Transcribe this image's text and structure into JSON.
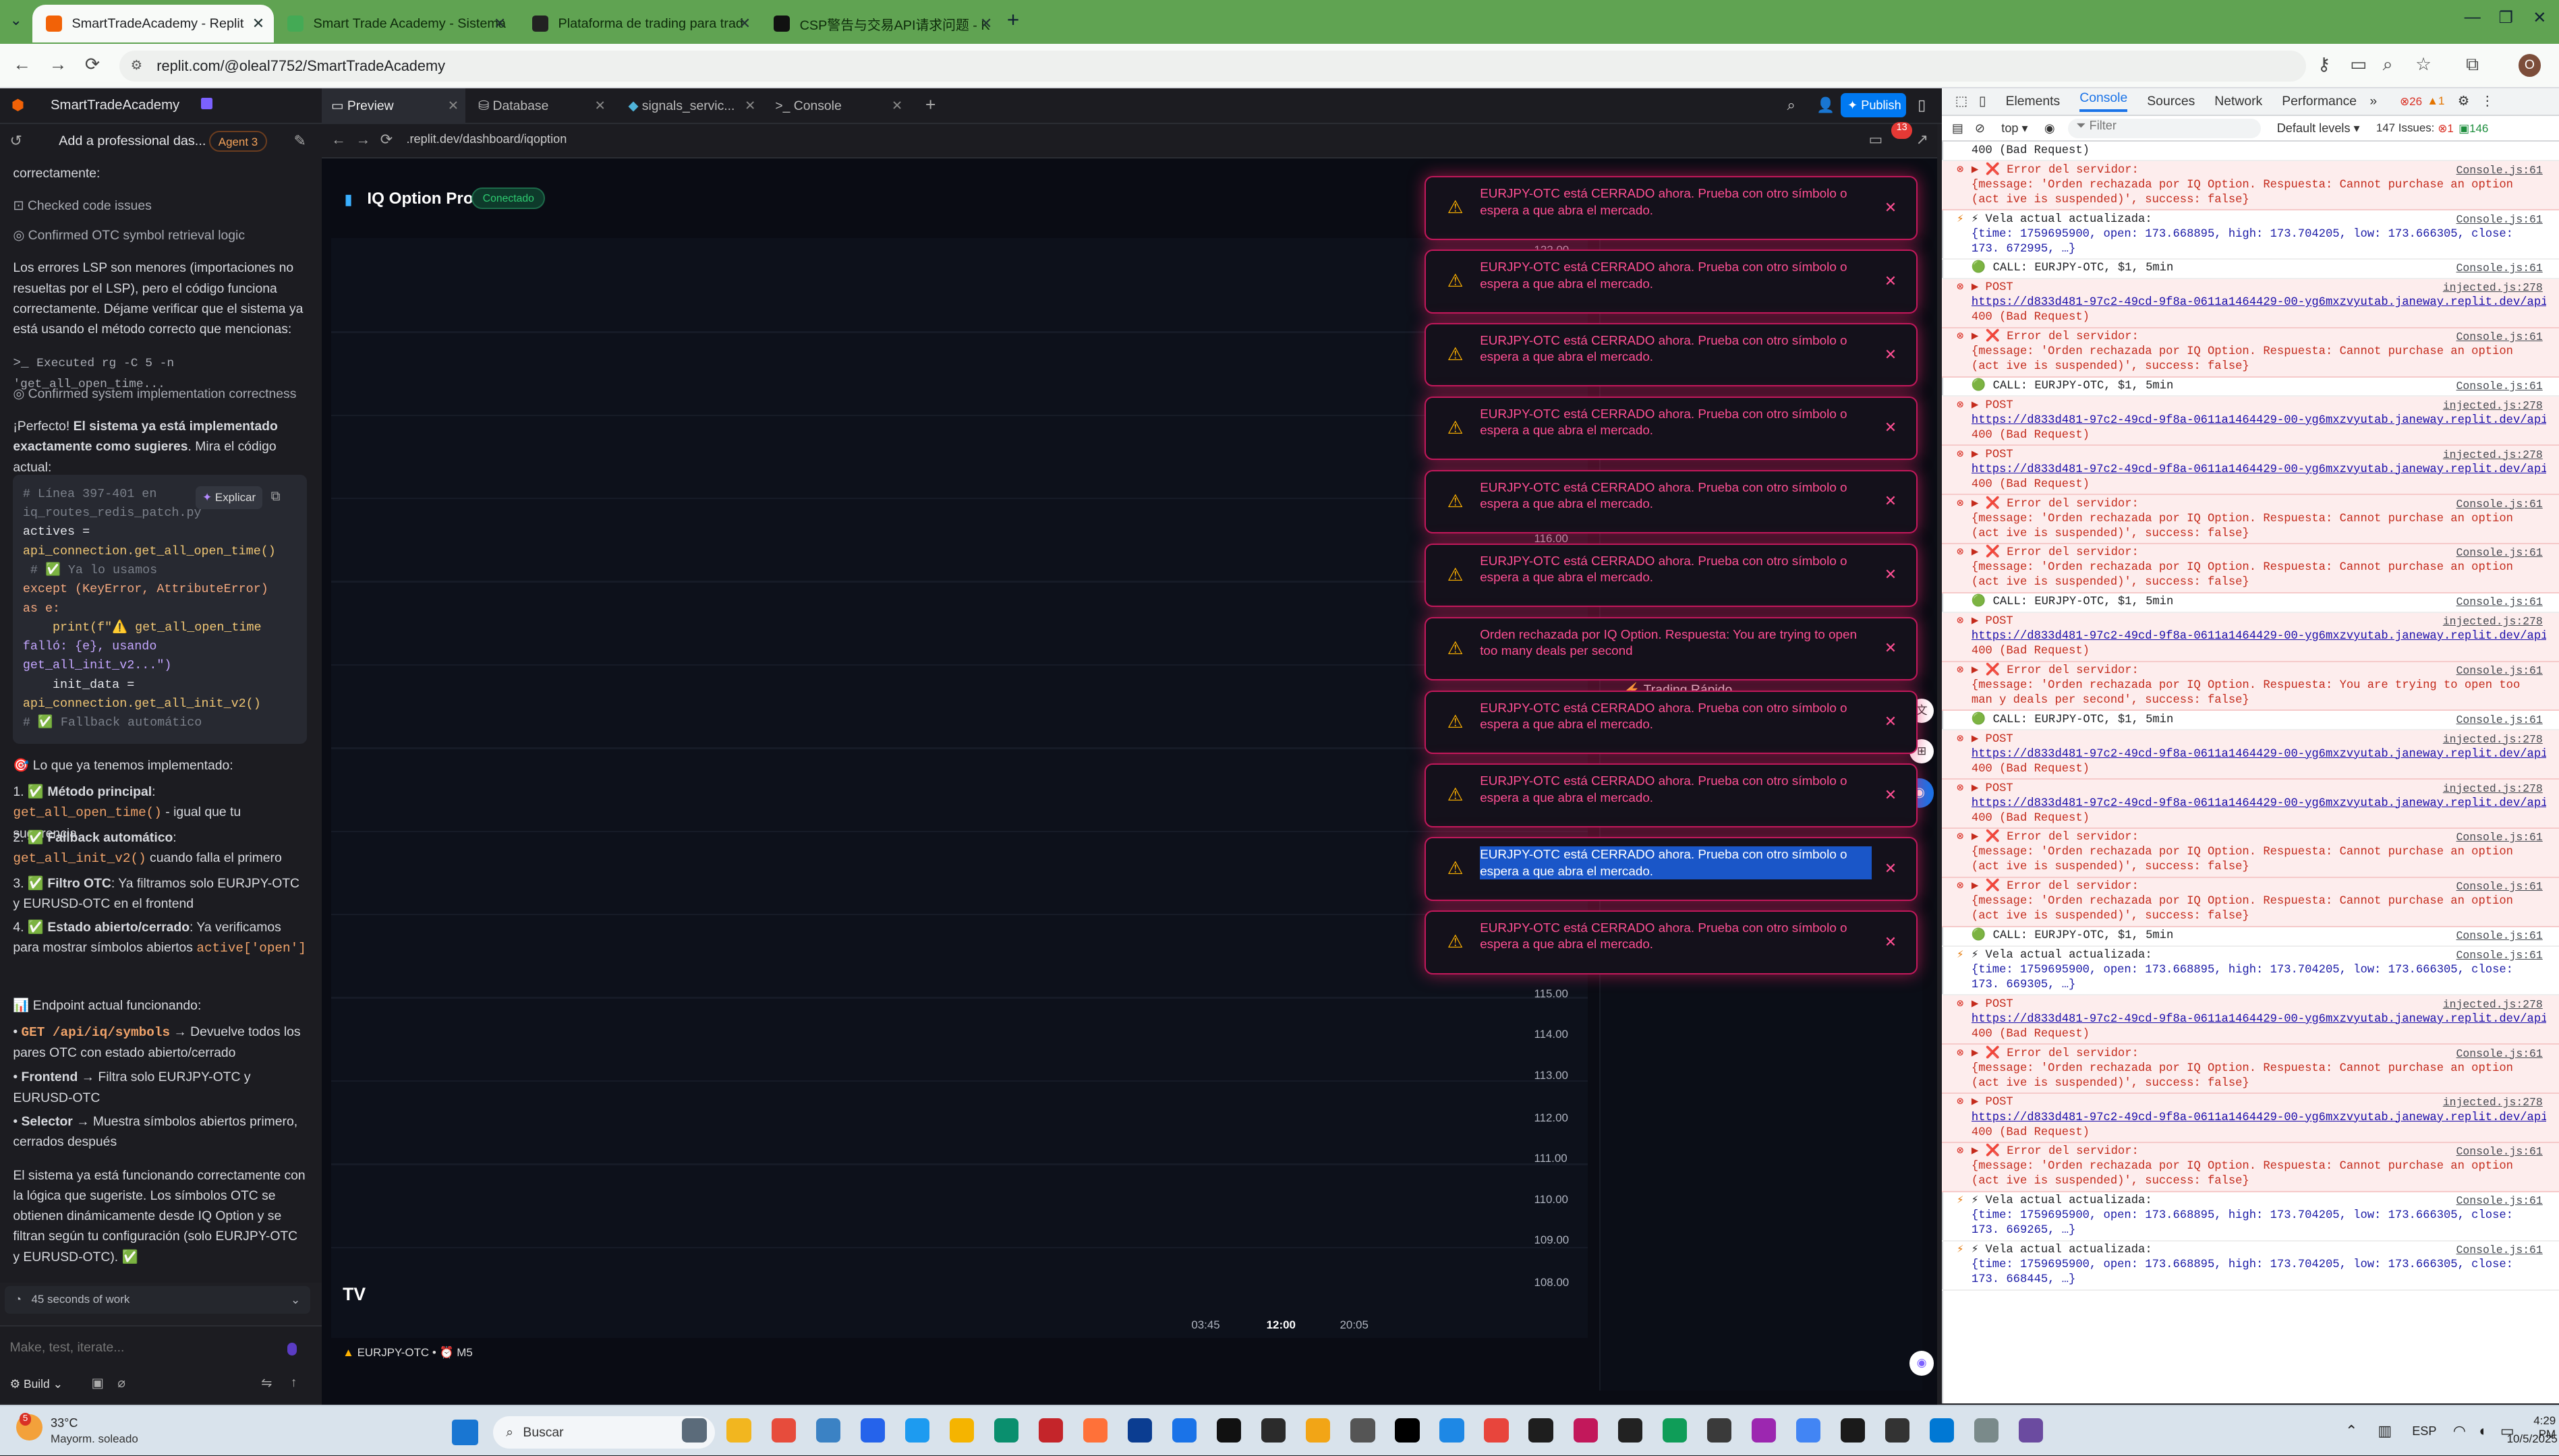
{
  "browser": {
    "tabs": [
      {
        "title": "SmartTradeAcademy - Replit",
        "active": true
      },
      {
        "title": "Smart Trade Academy - Sistema"
      },
      {
        "title": "Plataforma de trading para trad"
      },
      {
        "title": "CSP警告与交易API请求问题 - K"
      }
    ],
    "url": "replit.com/@oleal7752/SmartTradeAcademy"
  },
  "replit": {
    "project": "SmartTradeAcademy",
    "task": "Add a professional das...",
    "agent": "Agent 3",
    "tabs": [
      "Preview",
      "Database",
      "signals_servic...",
      "Console"
    ],
    "publish": "Publish",
    "preview_url": ".replit.dev/dashboard/iqoption"
  },
  "chat": {
    "l1": "correctamente:",
    "l2": "Checked code issues",
    "l3": "Confirmed OTC symbol retrieval logic",
    "p1": "Los errores LSP son menores (importaciones no resueltas por el LSP), pero el código funciona correctamente. Déjame verificar que el sistema ya está usando el método correcto que mencionas:",
    "l4": "Executed rg -C 5 -n 'get_all_open_time...",
    "l5": "Confirmed system implementation correctness",
    "p2a": "¡Perfecto! ",
    "p2b": "El sistema ya está implementado exactamente como sugieres",
    "p2c": ". Mira el código actual:",
    "code": [
      "# Línea 397-401 en",
      "iq_routes_redis_patch.py",
      "actives =",
      "api_connection.get_all_open_time()",
      " # ✅ Ya lo usamos",
      "except (KeyError, AttributeError)",
      "as e:",
      "    print(f\"⚠️ get_all_open_time",
      "falló: {e}, usando",
      "get_all_init_v2...\")",
      "    init_data =",
      "api_connection.get_all_init_v2()",
      "# ✅ Fallback automático"
    ],
    "explain": "Explicar",
    "h1": "🎯 Lo que ya tenemos implementado:",
    "items": [
      {
        "n": "1.",
        "b": "Método principal",
        "c": "get_all_open_time()",
        "t": " - igual que tu sugerencia"
      },
      {
        "n": "2.",
        "b": "Fallback automático",
        "c": "get_all_init_v2()",
        "t": " cuando falla el primero"
      },
      {
        "n": "3.",
        "b": "Filtro OTC",
        "c": "",
        "t": ": Ya filtramos solo EURJPY-OTC y EURUSD-OTC en el frontend"
      },
      {
        "n": "4.",
        "b": "Estado abierto/cerrado",
        "c": "active['open']",
        "t": ": Ya verificamos  para mostrar símbolos abiertos"
      }
    ],
    "h2": "📊 Endpoint actual funcionando:",
    "bul": [
      {
        "b": "GET /api/iq/symbols",
        "t": " → Devuelve todos los pares OTC con estado abierto/cerrado"
      },
      {
        "b": "Frontend",
        "t": " → Filtra solo EURJPY-OTC y EURUSD-OTC"
      },
      {
        "b": "Selector",
        "t": " → Muestra símbolos abiertos primero, cerrados después"
      }
    ],
    "p3": "El sistema ya está funcionando correctamente con la lógica que sugeriste. Los símbolos OTC se obtienen dinámicamente desde IQ Option y se filtran según tu configuración (solo EURJPY-OTC y EURUSD-OTC). ✅",
    "work": "45 seconds of work",
    "placeholder": "Make, test, iterate...",
    "build": "Build"
  },
  "app": {
    "title": "IQ Option Pro",
    "status": "Conectado",
    "symbol": "EURJPY-OTC • ⏰ M5",
    "notif_count": "13",
    "prices": [
      "122.00",
      "116.00",
      "115.00",
      "114.00",
      "113.00",
      "112.00",
      "111.00",
      "110.00",
      "109.00",
      "108.00"
    ],
    "times": [
      "03:45",
      "12:00",
      "20:05"
    ],
    "trading": "Trading Rápido",
    "toasts": [
      "EURJPY-OTC está CERRADO ahora. Prueba con otro símbolo o espera a que abra el mercado.",
      "EURJPY-OTC está CERRADO ahora. Prueba con otro símbolo o espera a que abra el mercado.",
      "EURJPY-OTC está CERRADO ahora. Prueba con otro símbolo o espera a que abra el mercado.",
      "EURJPY-OTC está CERRADO ahora. Prueba con otro símbolo o espera a que abra el mercado.",
      "EURJPY-OTC está CERRADO ahora. Prueba con otro símbolo o espera a que abra el mercado.",
      "EURJPY-OTC está CERRADO ahora. Prueba con otro símbolo o espera a que abra el mercado.",
      "Orden rechazada por IQ Option. Respuesta: You are trying to open too many deals per second",
      "EURJPY-OTC está CERRADO ahora. Prueba con otro símbolo o espera a que abra el mercado.",
      "EURJPY-OTC está CERRADO ahora. Prueba con otro símbolo o espera a que abra el mercado.",
      "EURJPY-OTC está CERRADO ahora. Prueba con otro símbolo o espera a que abra el mercado.",
      "EURJPY-OTC está CERRADO ahora. Prueba con otro símbolo o espera a que abra el mercado."
    ]
  },
  "devtools": {
    "tabs": [
      "Elements",
      "Console",
      "Sources",
      "Network",
      "Performance"
    ],
    "errors": "26",
    "warnings": "1",
    "issues": "147 Issues:",
    "issue_err": "1",
    "issue_info": "146",
    "context": "top",
    "filter": "Filter",
    "levels": "Default levels",
    "logs": [
      {
        "k": "plain",
        "t": "400 (Bad Request)"
      },
      {
        "k": "err",
        "t": "▶ ❌ Error del servidor:",
        "s": "{message: 'Orden rechazada por IQ Option. Respuesta: Cannot purchase an option (act ive is suspended)', success: false}",
        "src": "Console.js:61"
      },
      {
        "k": "warn",
        "t": "⚡ Vela actual actualizada:",
        "s": "{time: 1759695900, open: 173.668895, high: 173.704205, low: 173.666305, close: 173. 672995, …}",
        "src": "Console.js:61"
      },
      {
        "k": "plain",
        "t": "🟢 CALL: EURJPY-OTC, $1, 5min",
        "src": "Console.js:61"
      },
      {
        "k": "err",
        "t": "▶ POST",
        "l": "https://d833d481-97c2-49cd-9f8a-0611a1464429-00-yg6mxzvyutab.janeway.replit.dev/api/i...",
        "e": "400 (Bad Request)",
        "src": "injected.js:278"
      },
      {
        "k": "err",
        "t": "▶ ❌ Error del servidor:",
        "s": "{message: 'Orden rechazada por IQ Option. Respuesta: Cannot purchase an option (act ive is suspended)', success: false}",
        "src": "Console.js:61"
      },
      {
        "k": "plain",
        "t": "🟢 CALL: EURJPY-OTC, $1, 5min",
        "src": "Console.js:61"
      },
      {
        "k": "err",
        "t": "▶ POST",
        "l": "https://d833d481-97c2-49cd-9f8a-0611a1464429-00-yg6mxzvyutab.janeway.replit.dev/api/i...",
        "e": "400 (Bad Request)",
        "src": "injected.js:278"
      },
      {
        "k": "err",
        "t": "▶ POST",
        "l": "https://d833d481-97c2-49cd-9f8a-0611a1464429-00-yg6mxzvyutab.janeway.replit.dev/api/i...",
        "e": "400 (Bad Request)",
        "src": "injected.js:278"
      },
      {
        "k": "err",
        "t": "▶ ❌ Error del servidor:",
        "s": "{message: 'Orden rechazada por IQ Option. Respuesta: Cannot purchase an option (act ive is suspended)', success: false}",
        "src": "Console.js:61"
      },
      {
        "k": "err",
        "t": "▶ ❌ Error del servidor:",
        "s": "{message: 'Orden rechazada por IQ Option. Respuesta: Cannot purchase an option (act ive is suspended)', success: false}",
        "src": "Console.js:61"
      },
      {
        "k": "plain",
        "t": "🟢 CALL: EURJPY-OTC, $1, 5min",
        "src": "Console.js:61"
      },
      {
        "k": "err",
        "t": "▶ POST",
        "l": "https://d833d481-97c2-49cd-9f8a-0611a1464429-00-yg6mxzvyutab.janeway.replit.dev/api/i...",
        "e": "400 (Bad Request)",
        "src": "injected.js:278"
      },
      {
        "k": "err",
        "t": "▶ ❌ Error del servidor:",
        "s": "{message: 'Orden rechazada por IQ Option. Respuesta: You are trying to open too man y deals per second', success: false}",
        "src": "Console.js:61"
      },
      {
        "k": "plain",
        "t": "🟢 CALL: EURJPY-OTC, $1, 5min",
        "src": "Console.js:61"
      },
      {
        "k": "err",
        "t": "▶ POST",
        "l": "https://d833d481-97c2-49cd-9f8a-0611a1464429-00-yg6mxzvyutab.janeway.replit.dev/api/i...",
        "e": "400 (Bad Request)",
        "src": "injected.js:278"
      },
      {
        "k": "err",
        "t": "▶ POST",
        "l": "https://d833d481-97c2-49cd-9f8a-0611a1464429-00-yg6mxzvyutab.janeway.replit.dev/api/i...",
        "e": "400 (Bad Request)",
        "src": "injected.js:278"
      },
      {
        "k": "err",
        "t": "▶ ❌ Error del servidor:",
        "s": "{message: 'Orden rechazada por IQ Option. Respuesta: Cannot purchase an option (act ive is suspended)', success: false}",
        "src": "Console.js:61"
      },
      {
        "k": "err",
        "t": "▶ ❌ Error del servidor:",
        "s": "{message: 'Orden rechazada por IQ Option. Respuesta: Cannot purchase an option (act ive is suspended)', success: false}",
        "src": "Console.js:61"
      },
      {
        "k": "plain",
        "t": "🟢 CALL: EURJPY-OTC, $1, 5min",
        "src": "Console.js:61"
      },
      {
        "k": "warn",
        "t": "⚡ Vela actual actualizada:",
        "s": "{time: 1759695900, open: 173.668895, high: 173.704205, low: 173.666305, close: 173. 669305, …}",
        "src": "Console.js:61"
      },
      {
        "k": "err",
        "t": "▶ POST",
        "l": "https://d833d481-97c2-49cd-9f8a-0611a1464429-00-yg6mxzvyutab.janeway.replit.dev/api/i...",
        "e": "400 (Bad Request)",
        "src": "injected.js:278"
      },
      {
        "k": "err",
        "t": "▶ ❌ Error del servidor:",
        "s": "{message: 'Orden rechazada por IQ Option. Respuesta: Cannot purchase an option (act ive is suspended)', success: false}",
        "src": "Console.js:61"
      },
      {
        "k": "err",
        "t": "▶ POST",
        "l": "https://d833d481-97c2-49cd-9f8a-0611a1464429-00-yg6mxzvyutab.janeway.replit.dev/api/i...",
        "e": "400 (Bad Request)",
        "src": "injected.js:278"
      },
      {
        "k": "err",
        "t": "▶ ❌ Error del servidor:",
        "s": "{message: 'Orden rechazada por IQ Option. Respuesta: Cannot purchase an option (act ive is suspended)', success: false}",
        "src": "Console.js:61"
      },
      {
        "k": "warn",
        "t": "⚡ Vela actual actualizada:",
        "s": "{time: 1759695900, open: 173.668895, high: 173.704205, low: 173.666305, close: 173. 669265, …}",
        "src": "Console.js:61"
      },
      {
        "k": "warn",
        "t": "⚡ Vela actual actualizada:",
        "s": "{time: 1759695900, open: 173.668895, high: 173.704205, low: 173.666305, close: 173. 668445, …}",
        "src": "Console.js:61"
      }
    ]
  },
  "taskbar": {
    "temp": "33°C",
    "weather": "Mayorm. soleado",
    "search": "Buscar",
    "lang": "ESP",
    "time": "4:29 PM",
    "date": "10/5/2025",
    "badge": "5"
  }
}
